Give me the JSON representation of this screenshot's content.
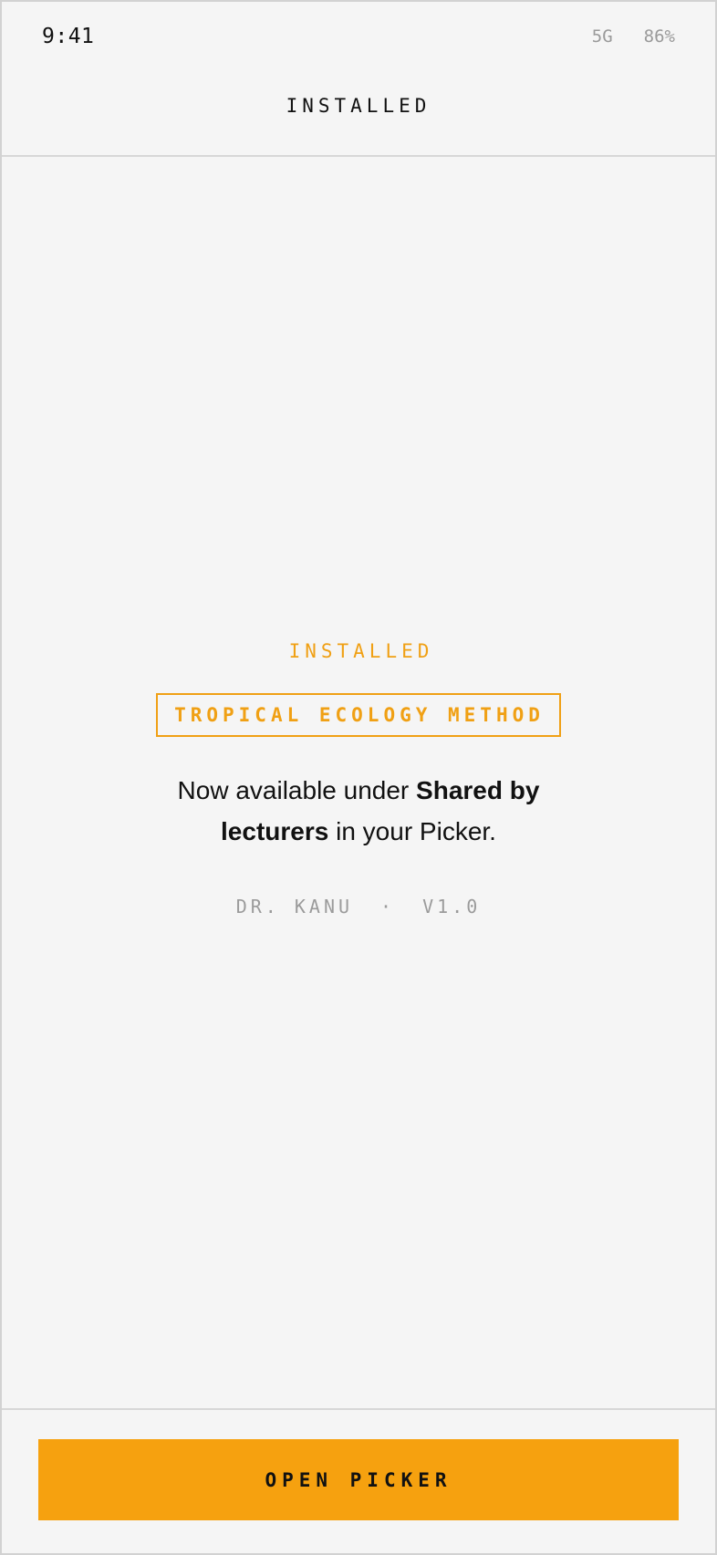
{
  "status_bar": {
    "time": "9:41",
    "network": "5G",
    "battery": "86%"
  },
  "nav": {
    "title": "INSTALLED"
  },
  "main": {
    "kicker": "INSTALLED",
    "package_name": "TROPICAL ECOLOGY METHOD",
    "message": {
      "prefix": "Now available under ",
      "highlight": "Shared by lecturers",
      "suffix": " in your Picker."
    },
    "author": "DR. KANU",
    "separator": "·",
    "version": "V1.0"
  },
  "footer": {
    "open_picker_label": "OPEN PICKER"
  },
  "colors": {
    "accent": "#f6a10f",
    "accent_text": "#f0a014",
    "background": "#f5f5f5",
    "divider": "#d7d7d7",
    "muted_text": "#9b9b9b",
    "text": "#111111"
  }
}
